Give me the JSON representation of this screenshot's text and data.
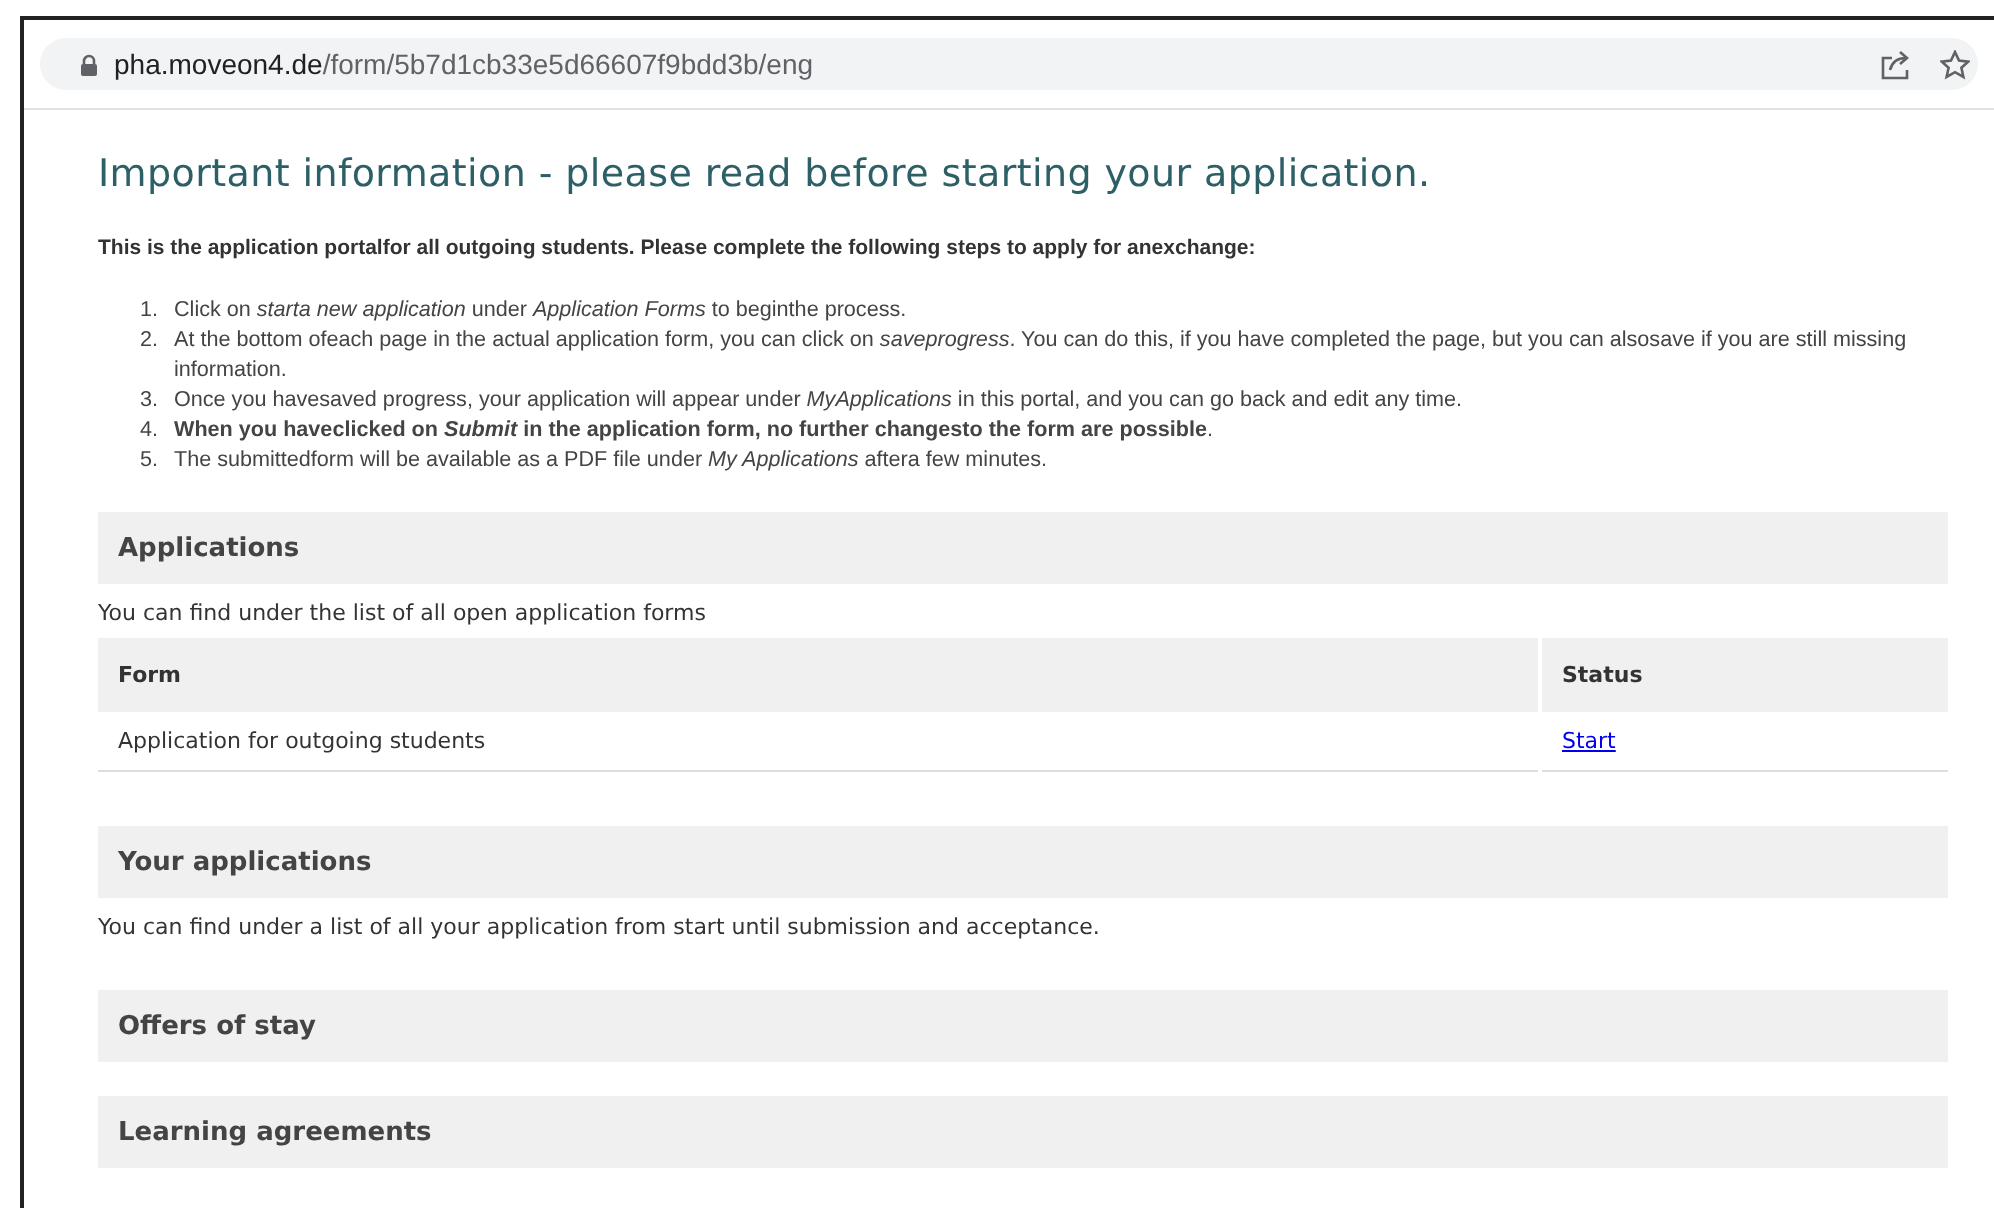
{
  "browser": {
    "url_host": "pha.moveon4.de",
    "url_path": "/form/5b7d1cb33e5d66607f9bdd3b/eng"
  },
  "page": {
    "title": "Important information - please read before starting your application.",
    "intro": "This is the application portalfor all outgoing students. Please complete the following steps to apply for anexchange:",
    "steps": [
      {
        "number": "1.",
        "text": "Click on *starta new application* under *Application Forms* to beginthe process."
      },
      {
        "number": "2.",
        "text": "At the bottom ofeach page in the actual application form, you can click on *saveprogress*. You can do this, if you have completed the page, but you can alsosave if you are still missing information."
      },
      {
        "number": "3.",
        "text": "Once you havesaved progress, your application will appear under *MyApplications* in this portal, and you can go back and edit any time."
      },
      {
        "number": "4.",
        "text": "**When you haveclicked on *Submit* in the application form, no further changesto the form are possible**."
      },
      {
        "number": "5.",
        "text": "The submittedform will be available as a PDF file under *My Applications* aftera few minutes."
      }
    ],
    "sections": [
      {
        "heading": "Applications",
        "description": "You can find under the list of all open application forms",
        "table": {
          "columns": [
            "Form",
            "Status"
          ],
          "rows": [
            {
              "form": "Application for outgoing students",
              "status": "Start"
            }
          ]
        }
      },
      {
        "heading": "Your applications",
        "description": "You can find under a list of all your application from start until submission and acceptance."
      },
      {
        "heading": "Offers of stay"
      },
      {
        "heading": "Learning agreements"
      }
    ]
  }
}
